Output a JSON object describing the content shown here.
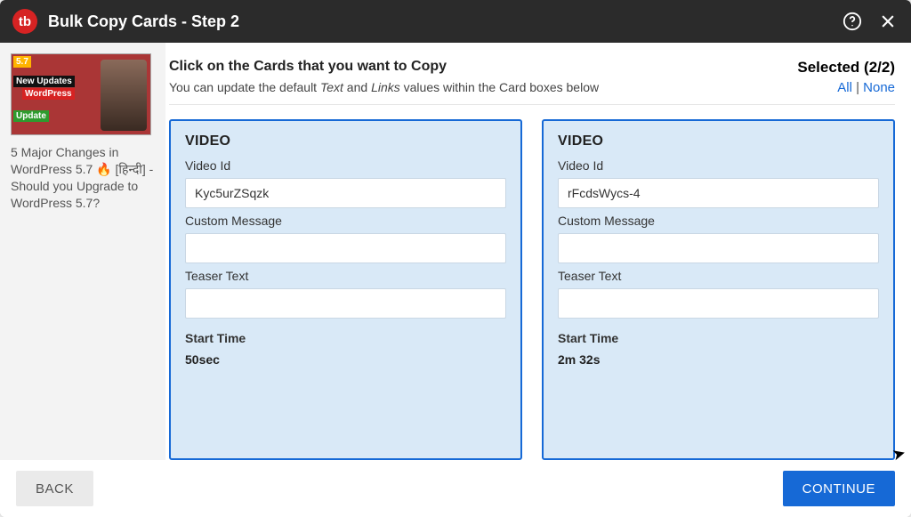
{
  "titlebar": {
    "logo_text": "tb",
    "title": "Bulk Copy Cards - Step 2"
  },
  "sidebar": {
    "video_title": "5 Major Changes in WordPress 5.7 🔥 [हिन्दी] - Should you Upgrade to WordPress 5.7?",
    "thumb_badges": {
      "tl": "5.7",
      "mid": "New Updates",
      "mid2": "WordPress",
      "bl": "Update"
    }
  },
  "header": {
    "heading": "Click on the Cards that you want to Copy",
    "sub_pre": "You can update the default ",
    "sub_text": "Text",
    "sub_and": " and ",
    "sub_links": "Links",
    "sub_post": " values within the Card boxes below",
    "selected_label": "Selected (2/2)",
    "all": "All",
    "sep": " | ",
    "none": "None"
  },
  "card_labels": {
    "type": "VIDEO",
    "video_id": "Video Id",
    "custom_message": "Custom Message",
    "teaser_text": "Teaser Text",
    "start_time": "Start Time"
  },
  "cards": [
    {
      "video_id": "Kyc5urZSqzk",
      "custom_message": "",
      "teaser_text": "",
      "start_time": "50sec"
    },
    {
      "video_id": "rFcdsWycs-4",
      "custom_message": "",
      "teaser_text": "",
      "start_time": "2m 32s"
    }
  ],
  "footer": {
    "back": "BACK",
    "continue": "CONTINUE"
  }
}
